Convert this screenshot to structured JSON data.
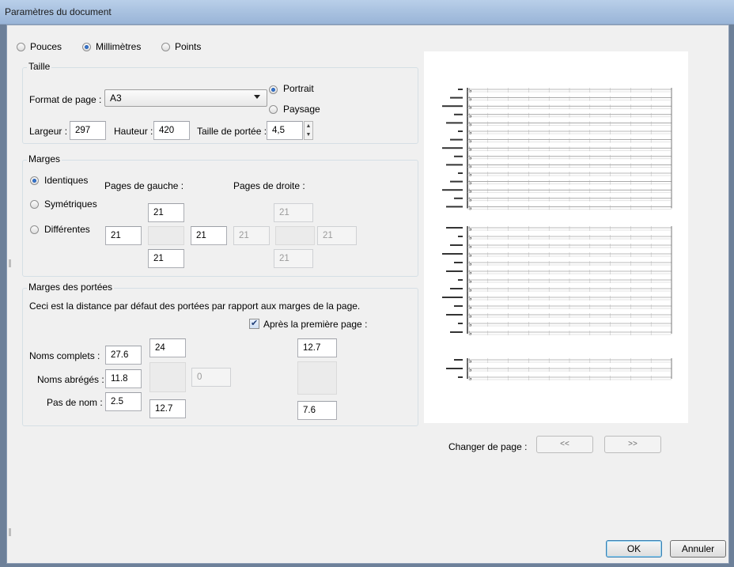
{
  "window": {
    "title": "Paramètres du document"
  },
  "units": {
    "options": [
      "Pouces",
      "Millimètres",
      "Points"
    ],
    "selected": "Millimètres"
  },
  "taille": {
    "legend": "Taille",
    "format_label": "Format de page :",
    "format_value": "A3",
    "orientation": {
      "portrait": "Portrait",
      "paysage": "Paysage",
      "selected": "Portrait"
    },
    "largeur_label": "Largeur :",
    "largeur_value": "297",
    "hauteur_label": "Hauteur :",
    "hauteur_value": "420",
    "portee_label": "Taille de portée :",
    "portee_value": "4,5"
  },
  "marges": {
    "legend": "Marges",
    "options": [
      "Identiques",
      "Symétriques",
      "Différentes"
    ],
    "selected": "Identiques",
    "gauche_label": "Pages de gauche :",
    "droite_label": "Pages de droite :",
    "gauche": {
      "top": "21",
      "left": "21",
      "right": "21",
      "bottom": "21"
    },
    "droite": {
      "top": "21",
      "left": "21",
      "right": "21",
      "bottom": "21"
    }
  },
  "marges_portees": {
    "legend": "Marges des portées",
    "description": "Ceci est la distance par défaut des portées par rapport aux marges de la page.",
    "apres_label": "Après la première page :",
    "apres_checked": true,
    "noms_complets_label": "Noms complets :",
    "noms_complets_value": "27.6",
    "noms_abreges_label": "Noms abrégés :",
    "noms_abreges_value": "11.8",
    "pas_de_nom_label": "Pas de nom :",
    "pas_de_nom_value": "2.5",
    "first_top": "24",
    "first_bottom": "12.7",
    "center_value": "0",
    "after_top": "12.7",
    "after_bottom": "7.6"
  },
  "preview": {
    "changer_label": "Changer de page :",
    "prev": "<<",
    "next": ">>"
  },
  "buttons": {
    "ok": "OK",
    "annuler": "Annuler"
  }
}
